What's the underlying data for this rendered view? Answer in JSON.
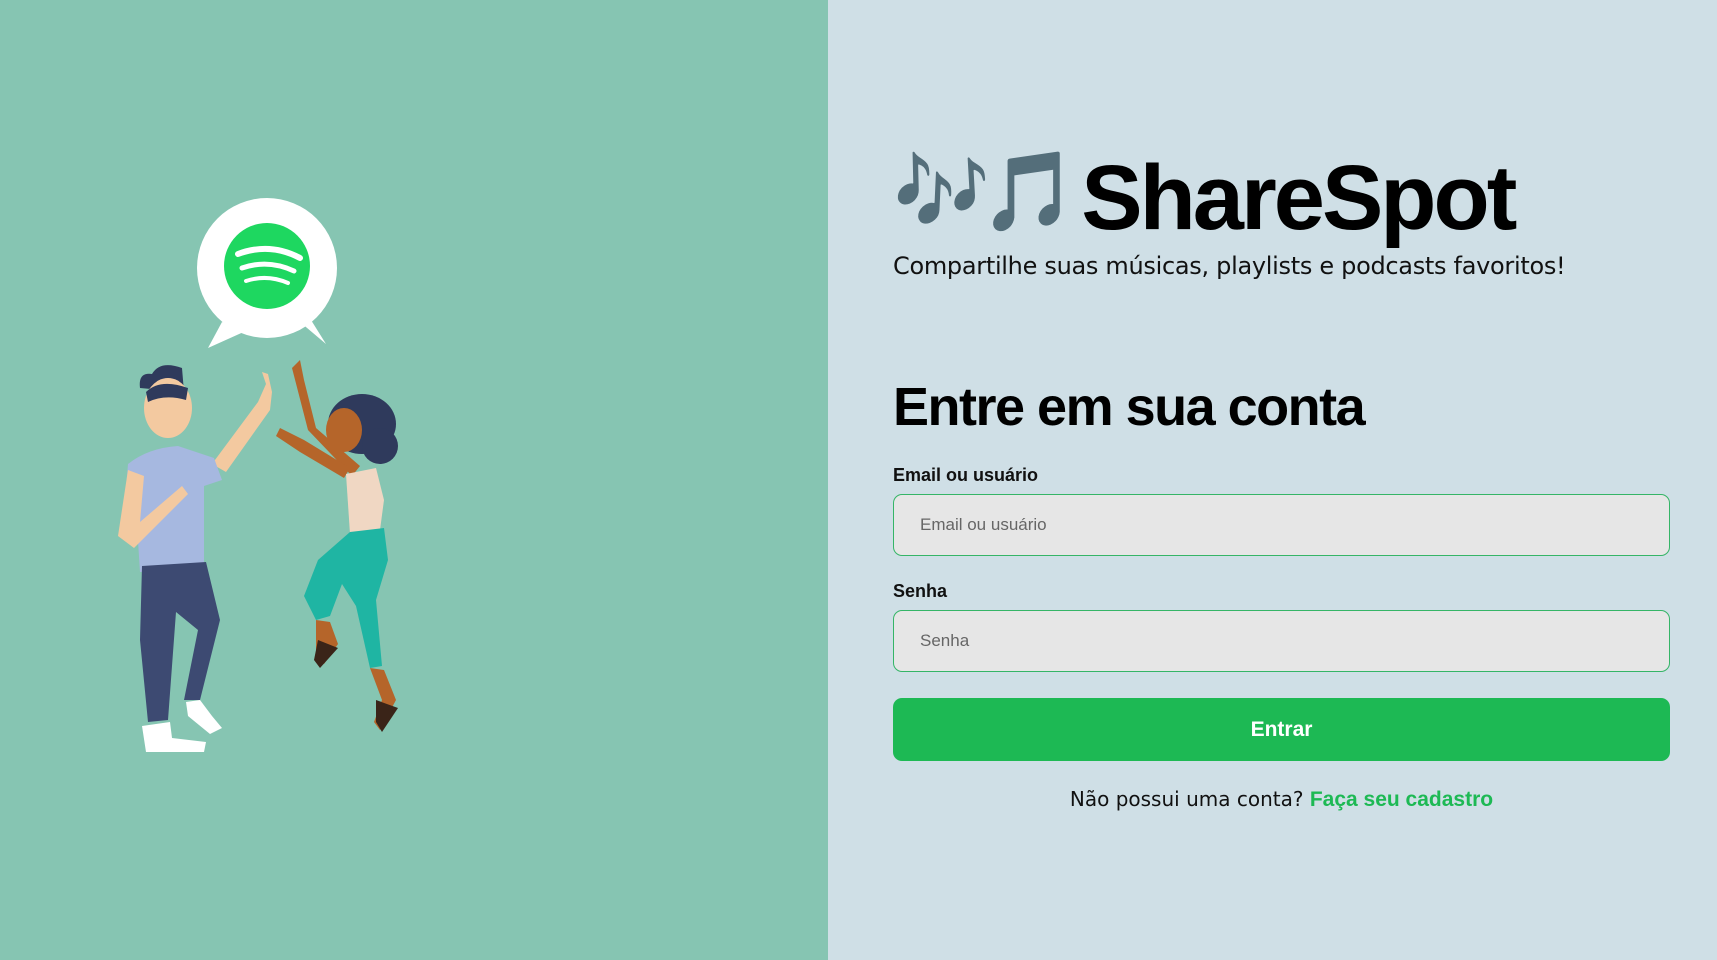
{
  "brand": {
    "notes": "🎶🎵",
    "name": "ShareSpot",
    "tagline": "Compartilhe suas músicas, playlists e podcasts favoritos!"
  },
  "login": {
    "title": "Entre em sua conta",
    "email_label": "Email ou usuário",
    "email_placeholder": "Email ou usuário",
    "email_value": "",
    "password_label": "Senha",
    "password_placeholder": "Senha",
    "password_value": "",
    "submit_label": "Entrar",
    "signup_prompt": "Não possui uma conta?",
    "signup_link": "Faça seu cadastro"
  },
  "illustration": {
    "icon": "spotify-logo-icon",
    "description_icons": [
      "speech-bubble-icon",
      "people-high-five-icon"
    ]
  },
  "colors": {
    "left_bg": "#86c5b2",
    "right_bg": "#cfdfe6",
    "accent": "#1db954"
  }
}
